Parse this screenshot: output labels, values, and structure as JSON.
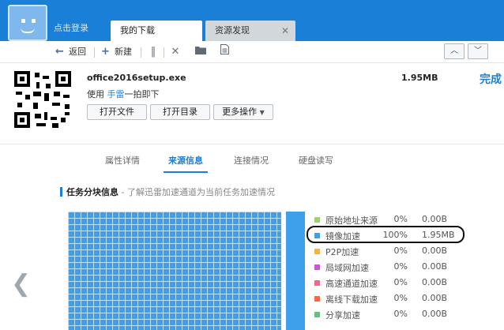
{
  "header": {
    "login_label": "点击登录",
    "tabs": [
      {
        "label": "我的下载",
        "active": true
      },
      {
        "label": "资源发现",
        "active": false
      }
    ],
    "close_glyph": "✕"
  },
  "toolbar": {
    "back_label": "返回",
    "new_label": "新建",
    "icons": [
      "pause-icon",
      "delete-icon",
      "folder-icon",
      "file-icon"
    ]
  },
  "task": {
    "filename": "office2016setup.exe",
    "size": "1.95MB",
    "status": "完成",
    "mobile_prefix": "使用 ",
    "mobile_link": "手雷",
    "mobile_suffix": "一拍即下",
    "buttons": {
      "open_file": "打开文件",
      "open_dir": "打开目录",
      "more": "更多操作"
    }
  },
  "subtabs": [
    "属性详情",
    "来源信息",
    "连接情况",
    "硬盘读写"
  ],
  "active_subtab": "来源信息",
  "section": {
    "title": "任务分块信息",
    "desc": " - 了解迅雷加速通道为当前任务加速情况"
  },
  "sources": [
    {
      "name": "原始地址来源",
      "percent": "0%",
      "size": "0.00B",
      "color": "#9bd36a"
    },
    {
      "name": "镜像加速",
      "percent": "100%",
      "size": "1.95MB",
      "color": "#3ea0ea"
    },
    {
      "name": "P2P加速",
      "percent": "0%",
      "size": "0.00B",
      "color": "#f5b436"
    },
    {
      "name": "局域网加速",
      "percent": "0%",
      "size": "0.00B",
      "color": "#c957d9"
    },
    {
      "name": "高速通道加速",
      "percent": "0%",
      "size": "0.00B",
      "color": "#f06a8e"
    },
    {
      "name": "离线下载加速",
      "percent": "0%",
      "size": "0.00B",
      "color": "#f26b45"
    },
    {
      "name": "分享加速",
      "percent": "0%",
      "size": "0.00B",
      "color": "#63c37d"
    }
  ],
  "colors": {
    "accent": "#1a7fd6",
    "topbar": "#1a7fd6"
  }
}
